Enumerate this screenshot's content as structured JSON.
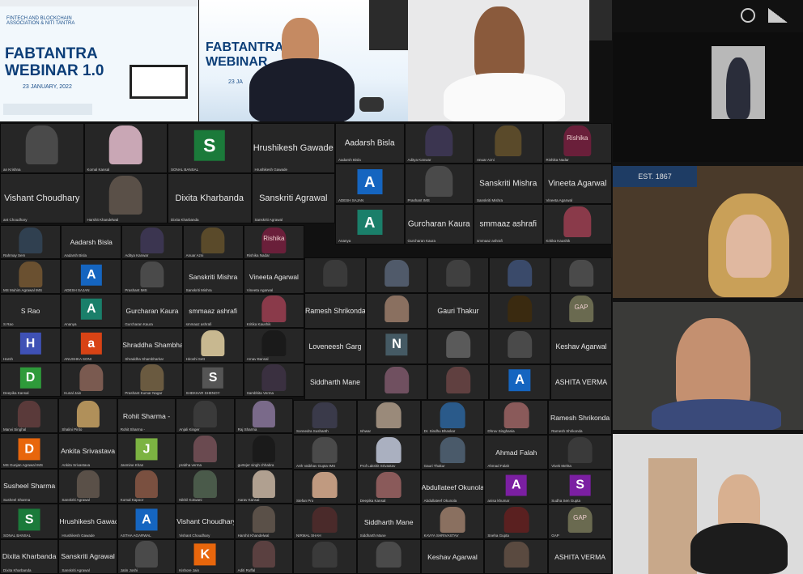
{
  "colors": {
    "tile_bg": "#262626",
    "screen_bg": "#111111",
    "blue": "#1565c0",
    "green": "#1b7a3a",
    "orange": "#e8660c"
  },
  "webinar": {
    "org": "FINTECH AND BLOCKCHAIN ASSOCIATION & NITI TANTRA",
    "title1": "FABTANTRA",
    "title2": "WEBINAR 1.0",
    "date": "23 JANUARY, 2022",
    "title_b1": "FABTANTRA",
    "title_b2": "WEBINAR",
    "date_b": "23 JA"
  },
  "grid_a": [
    {
      "name": "",
      "label": "an Krishna",
      "avatar_letter": "",
      "photo": "#4a4a4a"
    },
    {
      "name": "",
      "label": "Komal Kansal",
      "avatar_letter": "",
      "photo": "#c9a7b5"
    },
    {
      "name": "",
      "label": "SONAL BANSAL",
      "avatar_letter": "S",
      "avatar_color": "#1b7a3a"
    },
    {
      "name": "Hrushikesh Gawade",
      "label": "Hrushikesh Gawade",
      "avatar_letter": ""
    },
    {
      "name": "Vishant Choudhary",
      "label": "ant Choudhary",
      "avatar_letter": ""
    },
    {
      "name": "",
      "label": "Harshit Khandelwal",
      "avatar_letter": "",
      "photo": "#5a5048"
    },
    {
      "name": "Dixita Kharbanda",
      "label": "Dixita Kharbanda",
      "avatar_letter": ""
    },
    {
      "name": "Sanskriti Agrawal",
      "label": "Sanskriti Agrawal",
      "avatar_letter": ""
    }
  ],
  "grid_b": [
    {
      "name": "Aadarsh Bisla",
      "label": "Aadarsh Bisla",
      "avatar_letter": ""
    },
    {
      "name": "",
      "label": "Aditya Kanwar",
      "avatar_letter": "",
      "photo": "#3b3550"
    },
    {
      "name": "",
      "label": "Anuar Azni",
      "avatar_letter": "",
      "photo": "#5a4a2a"
    },
    {
      "name": "",
      "label": "Rishika Nadar",
      "avatar_letter": "",
      "photo": "#6a1f3a",
      "text": "Rishika"
    },
    {
      "name": "",
      "label": "ADESH SAJAN",
      "avatar_letter": "A",
      "avatar_color": "#1565c0"
    },
    {
      "name": "",
      "label": "Prashant IMS",
      "avatar_letter": "",
      "photo": "#4a4a4a"
    },
    {
      "name": "Sanskriti Mishra",
      "label": "Sanskriti Mishra",
      "avatar_letter": ""
    },
    {
      "name": "Vineeta Agarwal",
      "label": "Vineeta Agarwal",
      "avatar_letter": ""
    },
    {
      "name": "",
      "label": "Ananya",
      "avatar_letter": "A",
      "avatar_color": "#1a7f6a"
    },
    {
      "name": "Gurcharan Kaura",
      "label": "Gurcharan Kaura",
      "avatar_letter": ""
    },
    {
      "name": "smmaaz ashrafi",
      "label": "smmaaz ashrafi",
      "avatar_letter": ""
    },
    {
      "name": "",
      "label": "Kritika Kaushik",
      "avatar_letter": "",
      "photo": "#8a3a4a"
    }
  ],
  "grid_c": [
    {
      "name": "",
      "label": "Rahmay Sem",
      "avatar_letter": "",
      "photo": "#304050"
    },
    {
      "name": "Aadarsh Bisla",
      "label": "Aadarsh Bisla",
      "avatar_letter": ""
    },
    {
      "name": "",
      "label": "Aditya Kanwar",
      "avatar_letter": "",
      "photo": "#3b3550"
    },
    {
      "name": "",
      "label": "Anuar Azni",
      "avatar_letter": "",
      "photo": "#5a4a2a"
    },
    {
      "name": "",
      "label": "Rishika Nadar",
      "avatar_letter": "",
      "photo": "#6a1f3a",
      "text": "Rishika"
    },
    {
      "name": "",
      "label": "MS Muhim Agrawal IMS",
      "avatar_letter": "",
      "photo": "#6a5030"
    },
    {
      "name": "",
      "label": "ADESH SAJAN",
      "avatar_letter": "A",
      "avatar_color": "#1565c0"
    },
    {
      "name": "",
      "label": "Prashant IMS",
      "avatar_letter": "",
      "photo": "#4a4a4a"
    },
    {
      "name": "Sanskriti Mishra",
      "label": "Sanskriti Mishra",
      "avatar_letter": ""
    },
    {
      "name": "Vineeta Agarwal",
      "label": "Vineeta Agarwal",
      "avatar_letter": ""
    },
    {
      "name": "S Rao",
      "label": "S Rao",
      "avatar_letter": ""
    },
    {
      "name": "",
      "label": "Ananya",
      "avatar_letter": "A",
      "avatar_color": "#1a7f6a"
    },
    {
      "name": "Gurcharan Kaura",
      "label": "Gurcharan Kaura",
      "avatar_letter": ""
    },
    {
      "name": "smmaaz ashrafi",
      "label": "smmaaz ashrafi",
      "avatar_letter": ""
    },
    {
      "name": "",
      "label": "Kritika Kaushik",
      "avatar_letter": "",
      "photo": "#8a3a4a"
    },
    {
      "name": "",
      "label": "Harsh",
      "avatar_letter": "H",
      "avatar_color": "#3f51b5"
    },
    {
      "name": "",
      "label": "ANUSHKA SONI",
      "avatar_letter": "a",
      "avatar_color": "#d84315"
    },
    {
      "name": "Shraddha Shambharkar",
      "label": "Shraddha Shambharkar",
      "avatar_letter": ""
    },
    {
      "name": "",
      "label": "Hiroshi Sett",
      "avatar_letter": "",
      "photo": "#c8b890"
    },
    {
      "name": "",
      "label": "Arnav Bansal",
      "avatar_letter": "",
      "photo": "#1a1a1a"
    },
    {
      "name": "",
      "label": "Deepika Kansal",
      "avatar_letter": "D",
      "avatar_color": "#2e9a3a"
    },
    {
      "name": "",
      "label": "Kunal Jain",
      "avatar_letter": "",
      "photo": "#7a5a50"
    },
    {
      "name": "",
      "label": "Prashant Kumar Nagar",
      "avatar_letter": "",
      "photo": "#6a5a40"
    },
    {
      "name": "",
      "label": "SHEKHAR SHENOY",
      "avatar_letter": "S",
      "avatar_color": "#555555"
    },
    {
      "name": "",
      "label": "Sambhita Verma",
      "avatar_letter": "",
      "photo": "#3a3040"
    }
  ],
  "grid_d": [
    {
      "name": "",
      "label": "",
      "avatar_letter": "",
      "photo": "#3a3a3a"
    },
    {
      "name": "",
      "label": "",
      "avatar_letter": "",
      "photo": "#505a6a"
    },
    {
      "name": "",
      "label": "",
      "avatar_letter": "",
      "photo": "#404040"
    },
    {
      "name": "",
      "label": "",
      "avatar_letter": "",
      "photo": "#3a4a6a"
    },
    {
      "name": "",
      "label": "",
      "avatar_letter": "",
      "photo": "#4a4a4a"
    },
    {
      "name": "Ramesh Shrikonda",
      "label": "",
      "avatar_letter": ""
    },
    {
      "name": "",
      "label": "",
      "avatar_letter": "",
      "photo": "#8a7060"
    },
    {
      "name": "Gauri Thakur",
      "label": "",
      "avatar_letter": ""
    },
    {
      "name": "",
      "label": "",
      "avatar_letter": "",
      "photo": "#3a2a10"
    },
    {
      "name": "",
      "label": "",
      "avatar_letter": "",
      "photo": "#6a6a50",
      "text": "GAP"
    },
    {
      "name": "Loveneesh Garg",
      "label": "",
      "avatar_letter": ""
    },
    {
      "name": "",
      "label": "",
      "avatar_letter": "N",
      "avatar_color": "#455a64"
    },
    {
      "name": "",
      "label": "",
      "avatar_letter": "",
      "photo": "#5a5a5a"
    },
    {
      "name": "",
      "label": "",
      "avatar_letter": "",
      "photo": "#4a4a4a"
    },
    {
      "name": "Keshav Agarwal",
      "label": "",
      "avatar_letter": ""
    },
    {
      "name": "Siddharth Mane",
      "label": "",
      "avatar_letter": ""
    },
    {
      "name": "",
      "label": "",
      "avatar_letter": "",
      "photo": "#705060"
    },
    {
      "name": "",
      "label": "",
      "avatar_letter": "",
      "photo": "#604040"
    },
    {
      "name": "",
      "label": "",
      "avatar_letter": "A",
      "avatar_color": "#1565c0"
    },
    {
      "name": "ASHITA VERMA",
      "label": "",
      "avatar_letter": ""
    }
  ],
  "grid_e": [
    {
      "name": "",
      "label": "Manvi Singhal",
      "avatar_letter": "",
      "photo": "#5a3a3a"
    },
    {
      "name": "",
      "label": "Shalini Pinto",
      "avatar_letter": "",
      "photo": "#b0905a"
    },
    {
      "name": "Rohit Sharma -",
      "label": "Rohit Sharma -",
      "avatar_letter": ""
    },
    {
      "name": "",
      "label": "Anjali Kinger",
      "avatar_letter": "",
      "photo": "#3a3a3a"
    },
    {
      "name": "",
      "label": "Raj Sharma",
      "avatar_letter": "",
      "photo": "#7a6a8a"
    },
    {
      "name": "",
      "label": "MS Gunjan Agrawal IMS",
      "avatar_letter": "D",
      "avatar_color": "#e8660c"
    },
    {
      "name": "Ankita Srivastava",
      "label": "Ankita Srivastava",
      "avatar_letter": ""
    },
    {
      "name": "",
      "label": "Jasmine Khan",
      "avatar_letter": "J",
      "avatar_color": "#7cb342"
    },
    {
      "name": "",
      "label": "prabha verma",
      "avatar_letter": "",
      "photo": "#6a4a50"
    },
    {
      "name": "",
      "label": "gurtejer singh chhabra",
      "avatar_letter": "",
      "photo": "#1a1a1a"
    },
    {
      "name": "Susheel Sharma",
      "label": "Susheel Sharma",
      "avatar_letter": ""
    },
    {
      "name": "",
      "label": "Sanskriti Agrawal",
      "avatar_letter": "",
      "photo": "#5a5048"
    },
    {
      "name": "",
      "label": "Komal Kapoor",
      "avatar_letter": "",
      "photo": "#7a5040"
    },
    {
      "name": "",
      "label": "Nikhil Kotwani",
      "avatar_letter": "",
      "photo": "#4a5a4a"
    },
    {
      "name": "",
      "label": "Aarav Kansal",
      "avatar_letter": "",
      "photo": "#b0a090"
    },
    {
      "name": "",
      "label": "SONAL BANSAL",
      "avatar_letter": "S",
      "avatar_color": "#1b7a3a"
    },
    {
      "name": "Hrushikesh Gawade",
      "label": "Hrushikesh Gawade",
      "avatar_letter": ""
    },
    {
      "name": "",
      "label": "ASTHA AGARWAL",
      "avatar_letter": "A",
      "avatar_color": "#1565c0"
    },
    {
      "name": "Vishant Choudhary",
      "label": "Vishant Choudhary",
      "avatar_letter": ""
    },
    {
      "name": "",
      "label": "Harshit Khandelwal",
      "avatar_letter": "",
      "photo": "#5a5048"
    },
    {
      "name": "Dixita Kharbanda",
      "label": "Dixita Kharbanda",
      "avatar_letter": ""
    },
    {
      "name": "Sanskriti Agrawal",
      "label": "Sanskriti Agrawal",
      "avatar_letter": ""
    },
    {
      "name": "",
      "label": "Jatin Joshi",
      "avatar_letter": "",
      "photo": "#4a4a4a"
    },
    {
      "name": "",
      "label": "Kishore Jain",
      "avatar_letter": "K",
      "avatar_color": "#e8660c"
    },
    {
      "name": "",
      "label": "Aditi Ruffal",
      "avatar_letter": "",
      "photo": "#5a4040"
    }
  ],
  "grid_f": [
    {
      "name": "",
      "label": "Sonnedra Sushanth",
      "avatar_letter": "",
      "photo": "#3a3a4a"
    },
    {
      "name": "",
      "label": "Ishwar",
      "avatar_letter": "",
      "photo": "#9a8a7a"
    },
    {
      "name": "",
      "label": "Dr. Sindhu Bhaskar",
      "avatar_letter": "",
      "photo": "#2a5a8a"
    },
    {
      "name": "",
      "label": "Dhruv Singhania",
      "avatar_letter": "",
      "photo": "#8a5a5a"
    },
    {
      "name": "Ramesh Shrikonda",
      "label": "Ramesh Shrikonda",
      "avatar_letter": ""
    },
    {
      "name": "",
      "label": "Arth Vaibhav Gupta IMS",
      "avatar_letter": "",
      "photo": "#4a4a4a"
    },
    {
      "name": "",
      "label": "Prof Lakshit Srivastav",
      "avatar_letter": "",
      "photo": "#aab0c0"
    },
    {
      "name": "",
      "label": "Gauri Thakur",
      "avatar_letter": "",
      "photo": "#4a5a6a"
    },
    {
      "name": "Ahmad Falah",
      "label": "Ahmad Falah",
      "avatar_letter": ""
    },
    {
      "name": "",
      "label": "Vivek Mehta",
      "avatar_letter": "",
      "photo": "#3a3a3a"
    },
    {
      "name": "",
      "label": "Stefan Pro",
      "avatar_letter": "",
      "photo": "#c09a80"
    },
    {
      "name": "",
      "label": "Deepika Kansal",
      "avatar_letter": "",
      "photo": "#8a5a5a"
    },
    {
      "name": "Abdullateef Okunola",
      "label": "Abdullateef Okunola",
      "avatar_letter": ""
    },
    {
      "name": "",
      "label": "anisa khumar",
      "avatar_letter": "A",
      "avatar_color": "#7b1fa2"
    },
    {
      "name": "",
      "label": "Sudha Sen Gupta",
      "avatar_letter": "S",
      "avatar_color": "#7b1fa2"
    },
    {
      "name": "",
      "label": "NIRMAL SHAH",
      "avatar_letter": "",
      "photo": "#4a2a2a"
    },
    {
      "name": "Siddharth Mane",
      "label": "Siddharth Mane",
      "avatar_letter": ""
    },
    {
      "name": "",
      "label": "KAVYA SHRIVASTAV",
      "avatar_letter": "",
      "photo": "#8a7060"
    },
    {
      "name": "",
      "label": "Sneha Gupta",
      "avatar_letter": "",
      "photo": "#5a2020"
    },
    {
      "name": "",
      "label": "GAP",
      "avatar_letter": "",
      "photo": "#6a6a50",
      "text": "GAP"
    },
    {
      "name": "",
      "label": "",
      "avatar_letter": "",
      "photo": "#3a3a3a"
    },
    {
      "name": "",
      "label": "",
      "avatar_letter": "",
      "photo": "#4a4a4a"
    },
    {
      "name": "Keshav Agarwal",
      "label": "",
      "avatar_letter": ""
    },
    {
      "name": "",
      "label": "",
      "avatar_letter": "",
      "photo": "#5a4a40"
    },
    {
      "name": "ASHITA VERMA",
      "label": "",
      "avatar_letter": ""
    }
  ],
  "right_col": [
    {
      "label": "",
      "bg": "#0d0d0d"
    },
    {
      "label": "",
      "bg": "#9a9a9a"
    },
    {
      "label": "",
      "bg": "#4a3a2a"
    },
    {
      "label": "",
      "bg": "#dcdcdc"
    }
  ],
  "status": {
    "brand_text": "EST. 1867"
  }
}
